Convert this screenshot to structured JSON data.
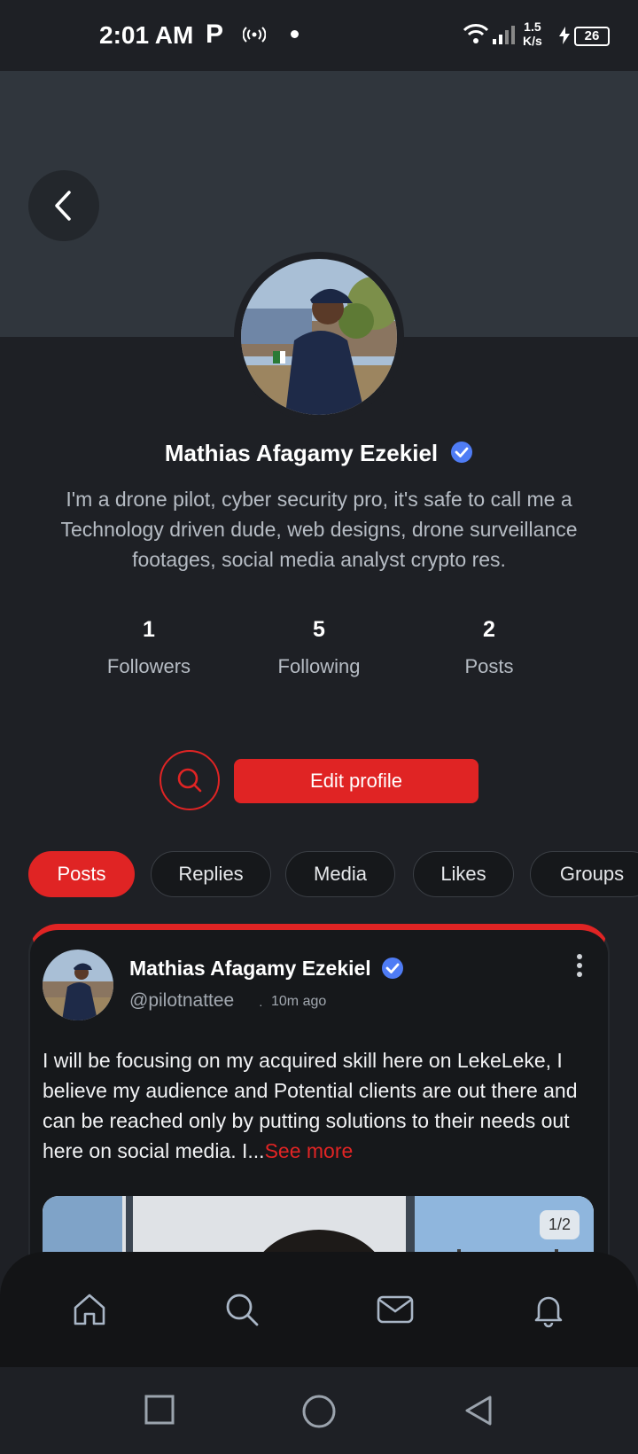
{
  "status_bar": {
    "time": "2:01 AM",
    "p_icon": "P",
    "net_speed_value": "1.5",
    "net_speed_unit": "K/s",
    "battery": "26"
  },
  "profile": {
    "name": "Mathias Afagamy Ezekiel",
    "bio": "I'm a drone pilot, cyber security pro, it's safe to call me a Technology driven dude, web designs, drone surveillance footages, social media analyst crypto res.",
    "stats": [
      {
        "value": "1",
        "label": "Followers"
      },
      {
        "value": "5",
        "label": "Following"
      },
      {
        "value": "2",
        "label": "Posts"
      }
    ],
    "edit_label": "Edit profile"
  },
  "tabs": [
    {
      "label": "Posts",
      "active": true
    },
    {
      "label": "Replies",
      "active": false
    },
    {
      "label": "Media",
      "active": false
    },
    {
      "label": "Likes",
      "active": false
    },
    {
      "label": "Groups",
      "active": false
    }
  ],
  "post": {
    "author": "Mathias Afagamy Ezekiel",
    "handle": "@pilotnattee",
    "separator": "·",
    "time": "10m ago",
    "text": "I will be focusing on my acquired skill here on LekeLeke, I believe my audience and Potential clients are out there and can be reached only by putting solutions to their needs out here on social media. I...",
    "see_more": "See more",
    "media_counter": "1/2"
  },
  "icons": {
    "back": "chevron-left-icon",
    "verified": "verified-badge-icon",
    "search": "search-icon",
    "more": "more-vertical-icon",
    "nav": [
      "home-icon",
      "search-icon",
      "mail-icon",
      "bell-icon"
    ],
    "system": [
      "recents-square-icon",
      "home-circle-icon",
      "back-triangle-icon"
    ]
  },
  "colors": {
    "accent": "#e02424",
    "verified": "#4f7cf5",
    "background": "#1e2025",
    "cover": "#30363d"
  }
}
